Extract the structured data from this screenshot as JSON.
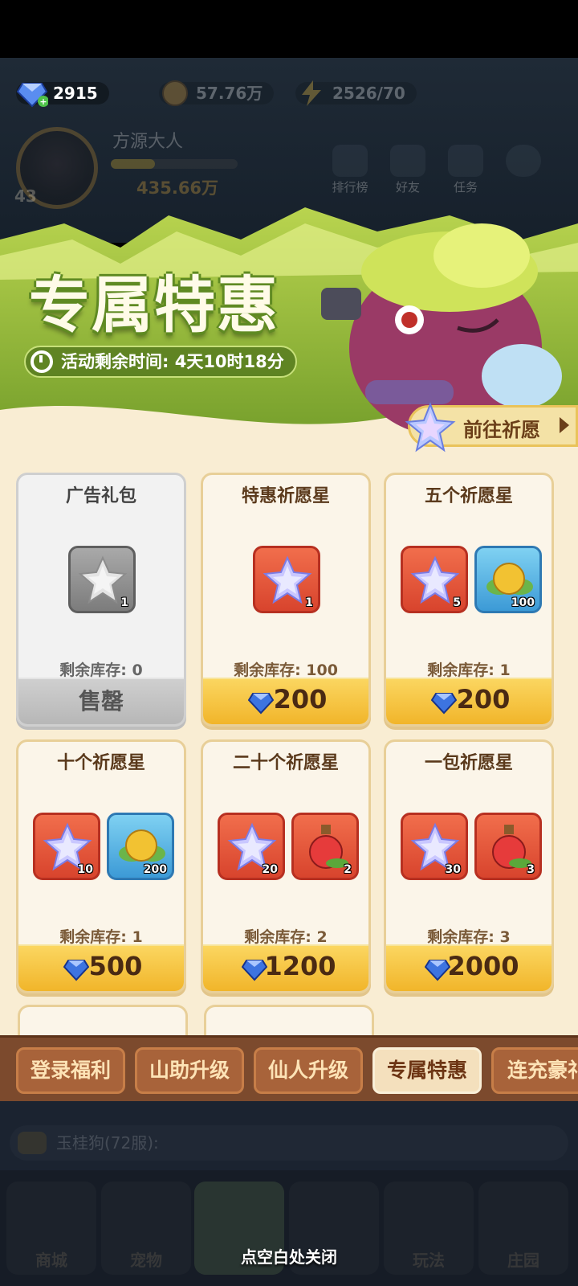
{
  "resources": {
    "diamond": "2915",
    "gold": "57.76万",
    "energy": "2526/70"
  },
  "player": {
    "name": "方源大人",
    "level": "43",
    "power": "435.66万"
  },
  "top_menu": [
    "排行榜",
    "好友",
    "任务"
  ],
  "banner": {
    "title": "专属特惠",
    "timer": "活动剩余时间: 4天10时18分",
    "go_button": "前往祈愿"
  },
  "packs": [
    {
      "title": "广告礼包",
      "stock": "剩余库存: 0",
      "price": "售罄",
      "sold_out": true,
      "items": [
        {
          "kind": "grey-star",
          "count": "1"
        }
      ]
    },
    {
      "title": "特惠祈愿星",
      "stock": "剩余库存: 100",
      "price": "200",
      "sold_out": false,
      "items": [
        {
          "kind": "star",
          "count": "1"
        }
      ]
    },
    {
      "title": "五个祈愿星",
      "stock": "剩余库存: 1",
      "price": "200",
      "sold_out": false,
      "items": [
        {
          "kind": "star",
          "count": "5"
        },
        {
          "kind": "gold-leaf",
          "count": "100"
        }
      ]
    },
    {
      "title": "十个祈愿星",
      "stock": "剩余库存: 1",
      "price": "500",
      "sold_out": false,
      "items": [
        {
          "kind": "star",
          "count": "10"
        },
        {
          "kind": "gold-leaf",
          "count": "200"
        }
      ]
    },
    {
      "title": "二十个祈愿星",
      "stock": "剩余库存: 2",
      "price": "1200",
      "sold_out": false,
      "items": [
        {
          "kind": "star",
          "count": "20"
        },
        {
          "kind": "potion",
          "count": "2"
        }
      ]
    },
    {
      "title": "一包祈愿星",
      "stock": "剩余库存: 3",
      "price": "2000",
      "sold_out": false,
      "items": [
        {
          "kind": "star",
          "count": "30"
        },
        {
          "kind": "potion",
          "count": "3"
        }
      ]
    }
  ],
  "tabs": [
    "登录福利",
    "山助升级",
    "仙人升级",
    "专属特惠",
    "连充豪礼"
  ],
  "active_tab": "专属特惠",
  "chat": {
    "sender": "玉桂狗(72服):"
  },
  "bottom_nav": [
    "商城",
    "宠物",
    "",
    "玩法",
    "庄园"
  ],
  "close_hint": "点空白处关闭",
  "colors": {
    "accent": "#f1b52a",
    "panel": "#f9edd3",
    "tab_bar": "#7c4a2d",
    "banner_green": "#8fb83a"
  }
}
